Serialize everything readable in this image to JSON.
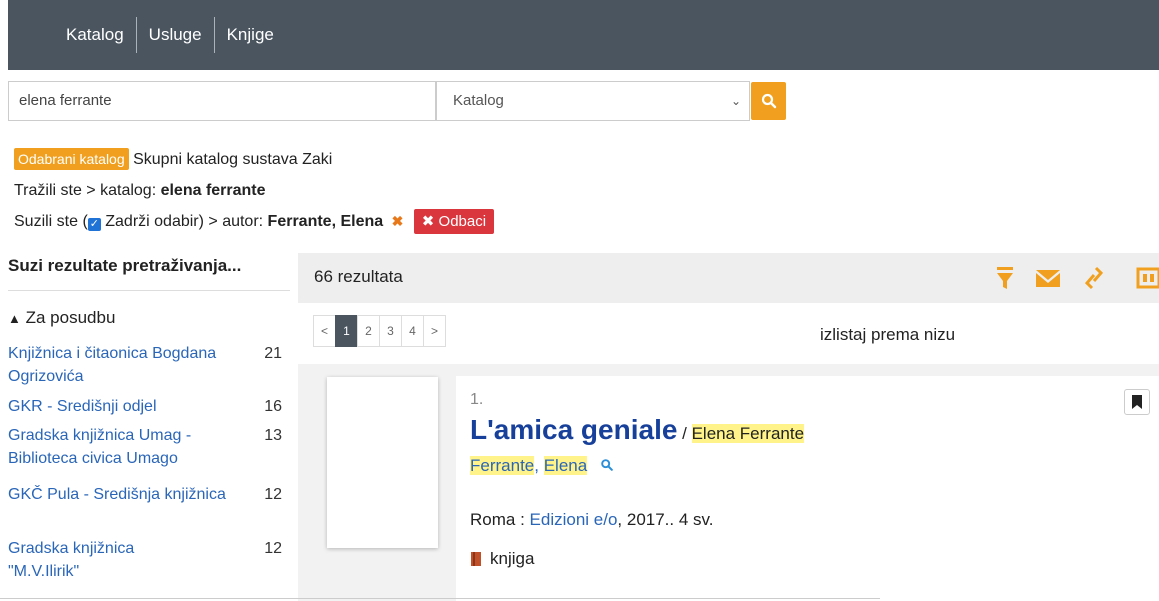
{
  "nav": {
    "items": [
      "Katalog",
      "Usluge",
      "Knjige"
    ]
  },
  "search": {
    "query": "elena ferrante",
    "scope": "Katalog"
  },
  "filters": {
    "selected_catalog_badge": "Odabrani katalog",
    "selected_catalog_name": "Skupni katalog sustava Zaki",
    "searched_prefix": "Tražili ste > katalog: ",
    "searched_term": "elena ferrante",
    "narrowed_prefix": "Suzili ste  (",
    "keep_selection_label": "Zadrži odabir",
    "narrowed_suffix": ") >  autor: ",
    "narrowed_author": "Ferrante, Elena",
    "discard_label": "Odbaci"
  },
  "sidebar": {
    "title": "Suzi rezultate pretraživanja...",
    "section": "Za posudbu",
    "facets": [
      {
        "name": "Knjižnica i čitaonica Bogdana Ogrizovića",
        "count": "21"
      },
      {
        "name": "GKR - Središnji odjel",
        "count": "16"
      },
      {
        "name": "Gradska knjižnica Umag - Biblioteca civica Umago",
        "count": "13"
      },
      {
        "name": "GKČ Pula - Središnja knjižnica",
        "count": "12"
      },
      {
        "name": "Gradska knjižnica \"M.V.Ilirik\"",
        "count": "12"
      }
    ]
  },
  "results": {
    "count_label": "66 rezultata",
    "pager": {
      "prev": "<",
      "pages": [
        "1",
        "2",
        "3",
        "4"
      ],
      "next": ">",
      "current": "1"
    },
    "sort_label": "izlistaj prema  nizu",
    "items": [
      {
        "number": "1.",
        "title": "L'amica geniale",
        "slash": " / ",
        "statement_author": "Elena Ferrante",
        "author_surname": "Ferrante",
        "author_sep": ", ",
        "author_given": "Elena",
        "pub_place": "Roma : ",
        "publisher": "Edizioni e/o",
        "pub_rest": ", 2017.. 4 sv.",
        "material_type": "knjiga"
      }
    ]
  },
  "colors": {
    "nav_bg": "#4a5560",
    "accent_orange": "#f0a01e",
    "discard_red": "#d9363e",
    "link_blue": "#2a66b8",
    "title_blue": "#17409a",
    "highlight": "#fff38a"
  }
}
